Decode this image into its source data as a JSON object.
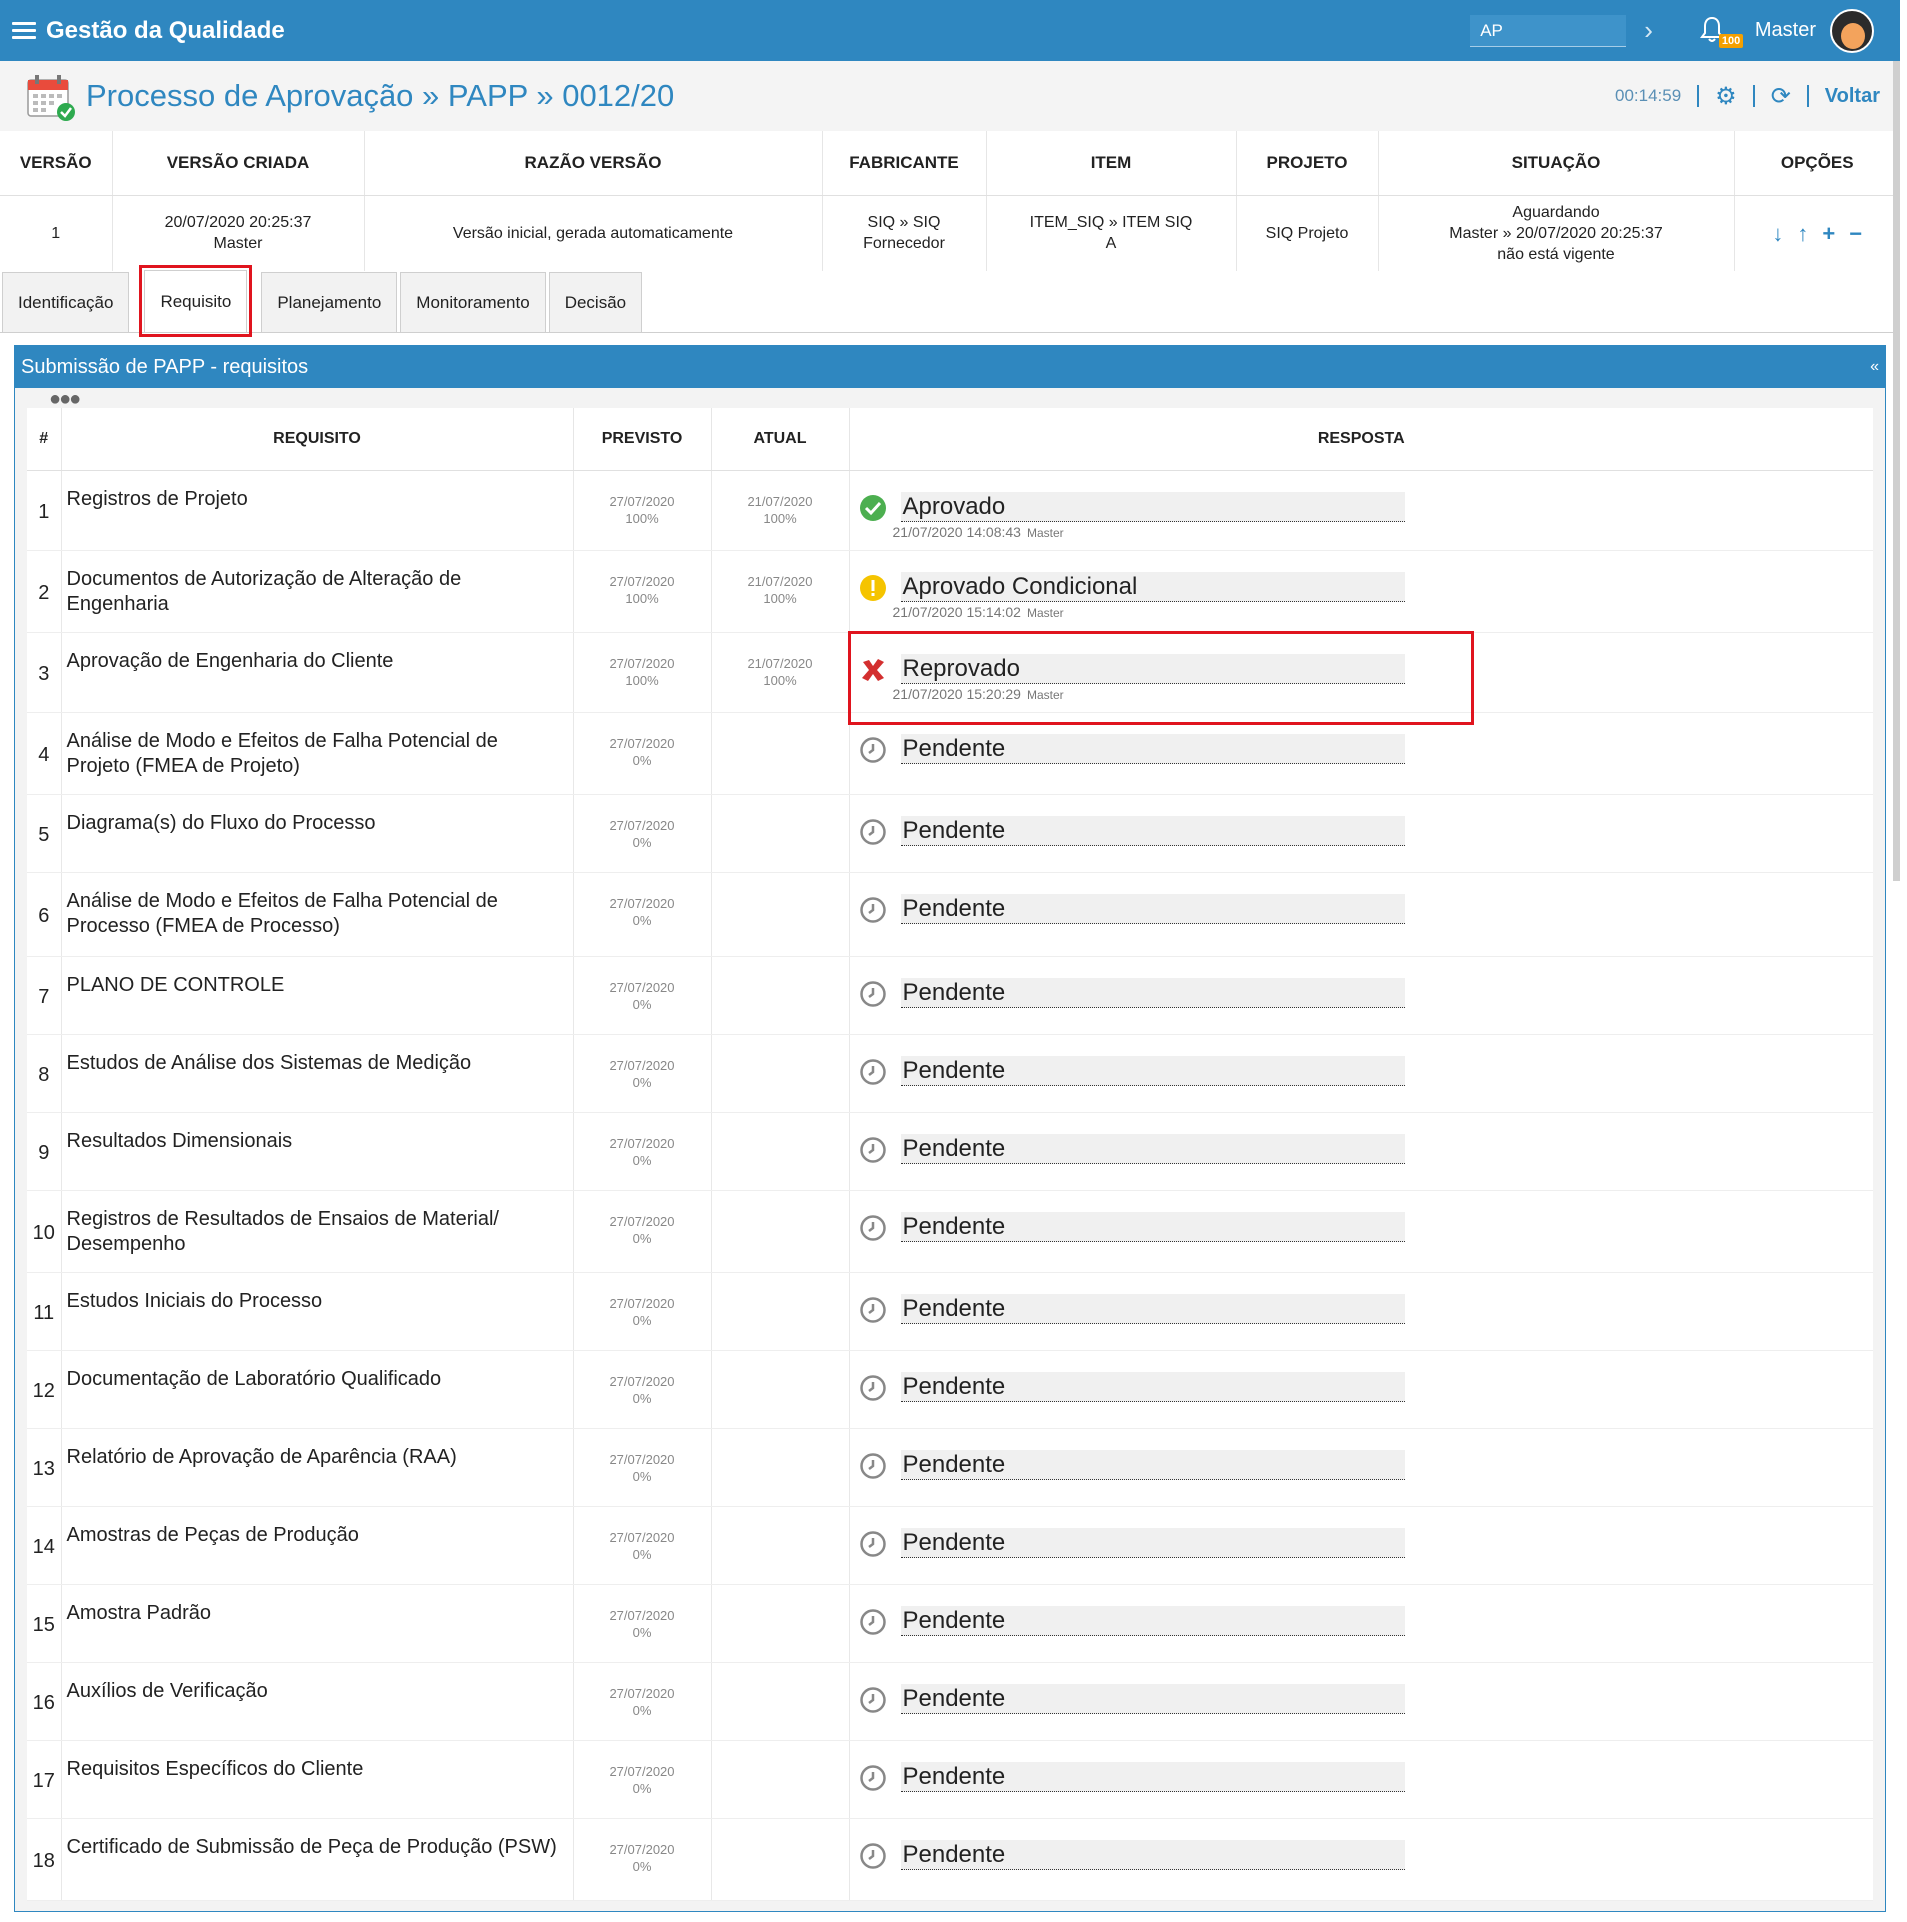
{
  "app": {
    "title": "Gestão da Qualidade",
    "search_value": "AP",
    "notification_count": "100",
    "user_name": "Master"
  },
  "header": {
    "title": "Processo de Aprovação » PAPP » 0012/20",
    "timer": "00:14:59",
    "back_label": "Voltar"
  },
  "version_table": {
    "headers": [
      "VERSÃO",
      "VERSÃO CRIADA",
      "RAZÃO VERSÃO",
      "FABRICANTE",
      "ITEM",
      "PROJETO",
      "SITUAÇÃO",
      "OPÇÕES"
    ],
    "row": {
      "versao": "1",
      "criada": "20/07/2020 20:25:37",
      "criada_user": "Master",
      "razao": "Versão inicial, gerada automaticamente",
      "fabricante": "SIQ » SIQ",
      "fabricante_2": "Fornecedor",
      "item": "ITEM_SIQ » ITEM SIQ",
      "item_2": "A",
      "projeto": "SIQ Projeto",
      "situacao_1": "Aguardando",
      "situacao_2": "Master » 20/07/2020 20:25:37",
      "situacao_3": "não está vigente"
    }
  },
  "tabs": [
    "Identificação",
    "Requisito",
    "Planejamento",
    "Monitoramento",
    "Decisão"
  ],
  "active_tab": "Requisito",
  "panel": {
    "title": "Submissão de PAPP - requisitos",
    "collapse_label": "«"
  },
  "req_table": {
    "headers": {
      "num": "#",
      "req": "REQUISITO",
      "prev": "PREVISTO",
      "atual": "ATUAL",
      "resp": "RESPOSTA"
    },
    "rows": [
      {
        "num": "1",
        "req": "Registros de Projeto",
        "prev_date": "27/07/2020",
        "prev_pct": "100%",
        "atual_date": "21/07/2020",
        "atual_pct": "100%",
        "status": "Aprovado",
        "status_icon": "check-icon",
        "meta_date": "21/07/2020 14:08:43",
        "meta_user": "Master"
      },
      {
        "num": "2",
        "req": "Documentos de Autorização de Alteração de Engenharia",
        "prev_date": "27/07/2020",
        "prev_pct": "100%",
        "atual_date": "21/07/2020",
        "atual_pct": "100%",
        "status": "Aprovado Condicional",
        "status_icon": "warning-icon",
        "meta_date": "21/07/2020 15:14:02",
        "meta_user": "Master"
      },
      {
        "num": "3",
        "req": "Aprovação de Engenharia do Cliente",
        "prev_date": "27/07/2020",
        "prev_pct": "100%",
        "atual_date": "21/07/2020",
        "atual_pct": "100%",
        "status": "Reprovado",
        "status_icon": "cross-icon",
        "meta_date": "21/07/2020 15:20:29",
        "meta_user": "Master"
      },
      {
        "num": "4",
        "req": "Análise de Modo e Efeitos de Falha Potencial de Projeto (FMEA de Projeto)",
        "prev_date": "27/07/2020",
        "prev_pct": "0%",
        "atual_date": "",
        "atual_pct": "",
        "status": "Pendente",
        "status_icon": "clock-icon",
        "meta_date": "",
        "meta_user": ""
      },
      {
        "num": "5",
        "req": "Diagrama(s) do Fluxo do Processo",
        "prev_date": "27/07/2020",
        "prev_pct": "0%",
        "atual_date": "",
        "atual_pct": "",
        "status": "Pendente",
        "status_icon": "clock-icon",
        "meta_date": "",
        "meta_user": ""
      },
      {
        "num": "6",
        "req": "Análise de Modo e Efeitos de Falha Potencial de Processo (FMEA de Processo)",
        "prev_date": "27/07/2020",
        "prev_pct": "0%",
        "atual_date": "",
        "atual_pct": "",
        "status": "Pendente",
        "status_icon": "clock-icon",
        "meta_date": "",
        "meta_user": ""
      },
      {
        "num": "7",
        "req": "PLANO DE CONTROLE",
        "prev_date": "27/07/2020",
        "prev_pct": "0%",
        "atual_date": "",
        "atual_pct": "",
        "status": "Pendente",
        "status_icon": "clock-icon",
        "meta_date": "",
        "meta_user": ""
      },
      {
        "num": "8",
        "req": "Estudos de Análise dos Sistemas de Medição",
        "prev_date": "27/07/2020",
        "prev_pct": "0%",
        "atual_date": "",
        "atual_pct": "",
        "status": "Pendente",
        "status_icon": "clock-icon",
        "meta_date": "",
        "meta_user": ""
      },
      {
        "num": "9",
        "req": "Resultados Dimensionais",
        "prev_date": "27/07/2020",
        "prev_pct": "0%",
        "atual_date": "",
        "atual_pct": "",
        "status": "Pendente",
        "status_icon": "clock-icon",
        "meta_date": "",
        "meta_user": ""
      },
      {
        "num": "10",
        "req": "Registros de Resultados de Ensaios de Material/ Desempenho",
        "prev_date": "27/07/2020",
        "prev_pct": "0%",
        "atual_date": "",
        "atual_pct": "",
        "status": "Pendente",
        "status_icon": "clock-icon",
        "meta_date": "",
        "meta_user": ""
      },
      {
        "num": "11",
        "req": "Estudos Iniciais do Processo",
        "prev_date": "27/07/2020",
        "prev_pct": "0%",
        "atual_date": "",
        "atual_pct": "",
        "status": "Pendente",
        "status_icon": "clock-icon",
        "meta_date": "",
        "meta_user": ""
      },
      {
        "num": "12",
        "req": "Documentação de Laboratório Qualificado",
        "prev_date": "27/07/2020",
        "prev_pct": "0%",
        "atual_date": "",
        "atual_pct": "",
        "status": "Pendente",
        "status_icon": "clock-icon",
        "meta_date": "",
        "meta_user": ""
      },
      {
        "num": "13",
        "req": "Relatório de Aprovação de Aparência (RAA)",
        "prev_date": "27/07/2020",
        "prev_pct": "0%",
        "atual_date": "",
        "atual_pct": "",
        "status": "Pendente",
        "status_icon": "clock-icon",
        "meta_date": "",
        "meta_user": ""
      },
      {
        "num": "14",
        "req": "Amostras de Peças de Produção",
        "prev_date": "27/07/2020",
        "prev_pct": "0%",
        "atual_date": "",
        "atual_pct": "",
        "status": "Pendente",
        "status_icon": "clock-icon",
        "meta_date": "",
        "meta_user": ""
      },
      {
        "num": "15",
        "req": "Amostra Padrão",
        "prev_date": "27/07/2020",
        "prev_pct": "0%",
        "atual_date": "",
        "atual_pct": "",
        "status": "Pendente",
        "status_icon": "clock-icon",
        "meta_date": "",
        "meta_user": ""
      },
      {
        "num": "16",
        "req": "Auxílios de Verificação",
        "prev_date": "27/07/2020",
        "prev_pct": "0%",
        "atual_date": "",
        "atual_pct": "",
        "status": "Pendente",
        "status_icon": "clock-icon",
        "meta_date": "",
        "meta_user": ""
      },
      {
        "num": "17",
        "req": "Requisitos Específicos do Cliente",
        "prev_date": "27/07/2020",
        "prev_pct": "0%",
        "atual_date": "",
        "atual_pct": "",
        "status": "Pendente",
        "status_icon": "clock-icon",
        "meta_date": "",
        "meta_user": ""
      },
      {
        "num": "18",
        "req": "Certificado de Submissão de Peça de Produção (PSW)",
        "prev_date": "27/07/2020",
        "prev_pct": "0%",
        "atual_date": "",
        "atual_pct": "",
        "status": "Pendente",
        "status_icon": "clock-icon",
        "meta_date": "",
        "meta_user": ""
      }
    ]
  },
  "colors": {
    "brand": "#2f87c0",
    "highlight": "#e0141e",
    "approved": "#4caf50",
    "warning": "#f5c400",
    "rejected": "#d32f2f",
    "pending": "#888888"
  },
  "highlighted_row": "3"
}
